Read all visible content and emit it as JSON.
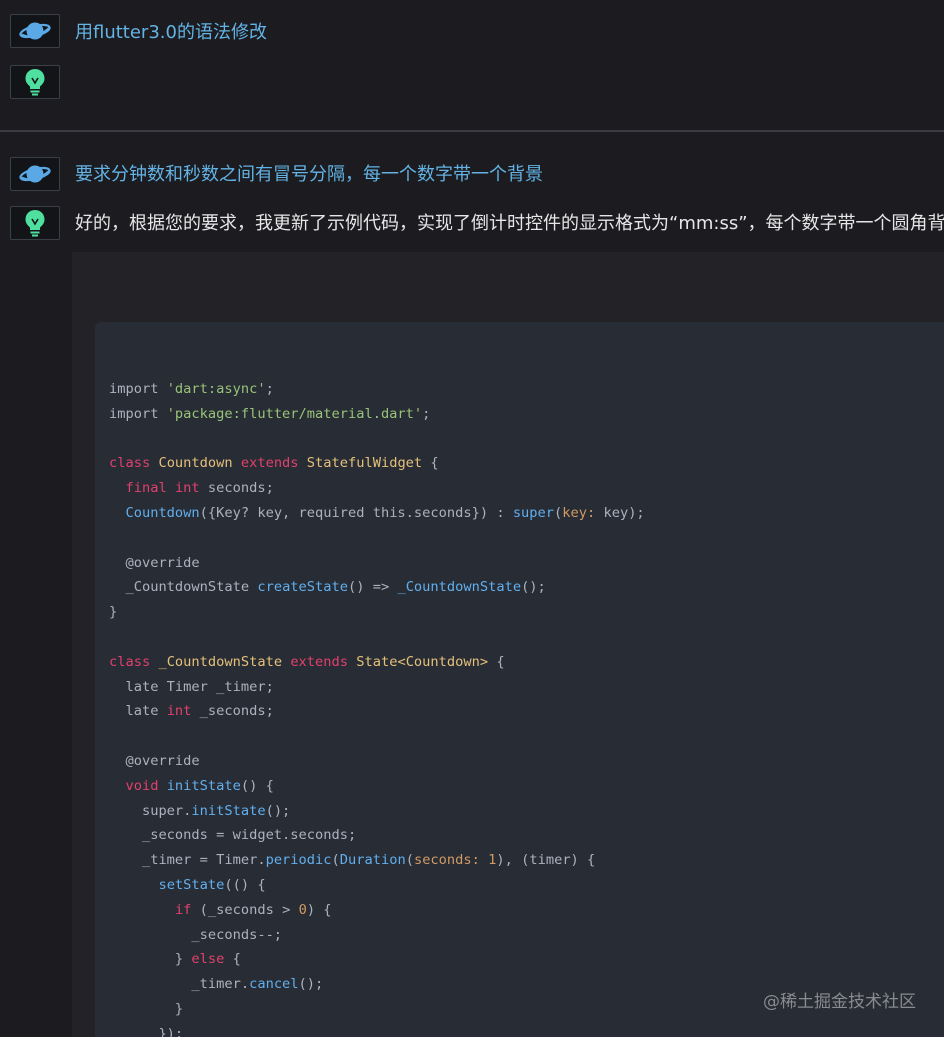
{
  "conversation": [
    {
      "role": "user",
      "avatar_icon": "planet-icon",
      "text": "用flutter3.0的语法修改"
    },
    {
      "role": "assistant",
      "avatar_icon": "lightbulb-icon",
      "text": ""
    },
    {
      "role": "user",
      "avatar_icon": "planet-icon",
      "text": "要求分钟数和秒数之间有冒号分隔，每一个数字带一个背景"
    },
    {
      "role": "assistant",
      "avatar_icon": "lightbulb-icon",
      "text": "好的，根据您的要求，我更新了示例代码，实现了倒计时控件的显示格式为“mm:ss”，每个数字带一个圆角背景。"
    }
  ],
  "colors": {
    "page_bg": "#1c1b20",
    "user_text": "#63b3e4",
    "bot_text": "#e6e6e6",
    "code_bg": "#282c34",
    "icon_user": "#5aa9e6",
    "icon_bot": "#4fe0a0"
  },
  "code": {
    "language": "dart",
    "lines": [
      [
        {
          "t": "import ",
          "c": "plain"
        },
        {
          "t": "'dart:async'",
          "c": "str"
        },
        {
          "t": ";",
          "c": "plain"
        }
      ],
      [
        {
          "t": "import ",
          "c": "plain"
        },
        {
          "t": "'package:flutter/material.dart'",
          "c": "str"
        },
        {
          "t": ";",
          "c": "plain"
        }
      ],
      [],
      [
        {
          "t": "class ",
          "c": "kw"
        },
        {
          "t": "Countdown ",
          "c": "cls"
        },
        {
          "t": "extends ",
          "c": "kw"
        },
        {
          "t": "StatefulWidget",
          "c": "cls"
        },
        {
          "t": " {",
          "c": "plain"
        }
      ],
      [
        {
          "t": "  ",
          "c": "plain"
        },
        {
          "t": "final ",
          "c": "kw"
        },
        {
          "t": "int",
          "c": "kw"
        },
        {
          "t": " seconds;",
          "c": "plain"
        }
      ],
      [
        {
          "t": "  ",
          "c": "plain"
        },
        {
          "t": "Countdown",
          "c": "fn"
        },
        {
          "t": "({Key? key, required this.seconds}) : ",
          "c": "plain"
        },
        {
          "t": "super",
          "c": "fn"
        },
        {
          "t": "(",
          "c": "plain"
        },
        {
          "t": "key:",
          "c": "param"
        },
        {
          "t": " key);",
          "c": "plain"
        }
      ],
      [],
      [
        {
          "t": "  @override",
          "c": "plain"
        }
      ],
      [
        {
          "t": "  _CountdownState ",
          "c": "plain"
        },
        {
          "t": "createState",
          "c": "fn"
        },
        {
          "t": "() => ",
          "c": "plain"
        },
        {
          "t": "_CountdownState",
          "c": "fn"
        },
        {
          "t": "();",
          "c": "plain"
        }
      ],
      [
        {
          "t": "}",
          "c": "plain"
        }
      ],
      [],
      [
        {
          "t": "class ",
          "c": "kw"
        },
        {
          "t": "_CountdownState ",
          "c": "cls"
        },
        {
          "t": "extends ",
          "c": "kw"
        },
        {
          "t": "State<Countdown>",
          "c": "cls"
        },
        {
          "t": " {",
          "c": "plain"
        }
      ],
      [
        {
          "t": "  late Timer _timer;",
          "c": "plain"
        }
      ],
      [
        {
          "t": "  late ",
          "c": "plain"
        },
        {
          "t": "int",
          "c": "kw"
        },
        {
          "t": " _seconds;",
          "c": "plain"
        }
      ],
      [],
      [
        {
          "t": "  @override",
          "c": "plain"
        }
      ],
      [
        {
          "t": "  ",
          "c": "plain"
        },
        {
          "t": "void ",
          "c": "kw"
        },
        {
          "t": "initState",
          "c": "fn"
        },
        {
          "t": "() {",
          "c": "plain"
        }
      ],
      [
        {
          "t": "    super.",
          "c": "plain"
        },
        {
          "t": "initState",
          "c": "fn"
        },
        {
          "t": "();",
          "c": "plain"
        }
      ],
      [
        {
          "t": "    _seconds = widget.seconds;",
          "c": "plain"
        }
      ],
      [
        {
          "t": "    _timer = Timer.",
          "c": "plain"
        },
        {
          "t": "periodic",
          "c": "fn"
        },
        {
          "t": "(",
          "c": "plain"
        },
        {
          "t": "Duration",
          "c": "fn"
        },
        {
          "t": "(",
          "c": "plain"
        },
        {
          "t": "seconds:",
          "c": "param"
        },
        {
          "t": " ",
          "c": "plain"
        },
        {
          "t": "1",
          "c": "num"
        },
        {
          "t": "), (timer) {",
          "c": "plain"
        }
      ],
      [
        {
          "t": "      ",
          "c": "plain"
        },
        {
          "t": "setState",
          "c": "fn"
        },
        {
          "t": "(() {",
          "c": "plain"
        }
      ],
      [
        {
          "t": "        ",
          "c": "plain"
        },
        {
          "t": "if",
          "c": "kw"
        },
        {
          "t": " (_seconds > ",
          "c": "plain"
        },
        {
          "t": "0",
          "c": "num"
        },
        {
          "t": ") {",
          "c": "plain"
        }
      ],
      [
        {
          "t": "          _seconds--;",
          "c": "plain"
        }
      ],
      [
        {
          "t": "        } ",
          "c": "plain"
        },
        {
          "t": "else",
          "c": "kw"
        },
        {
          "t": " {",
          "c": "plain"
        }
      ],
      [
        {
          "t": "          _timer.",
          "c": "plain"
        },
        {
          "t": "cancel",
          "c": "fn"
        },
        {
          "t": "();",
          "c": "plain"
        }
      ],
      [
        {
          "t": "        }",
          "c": "plain"
        }
      ],
      [
        {
          "t": "      });",
          "c": "plain"
        }
      ]
    ]
  },
  "watermark": "@稀土掘金技术社区"
}
